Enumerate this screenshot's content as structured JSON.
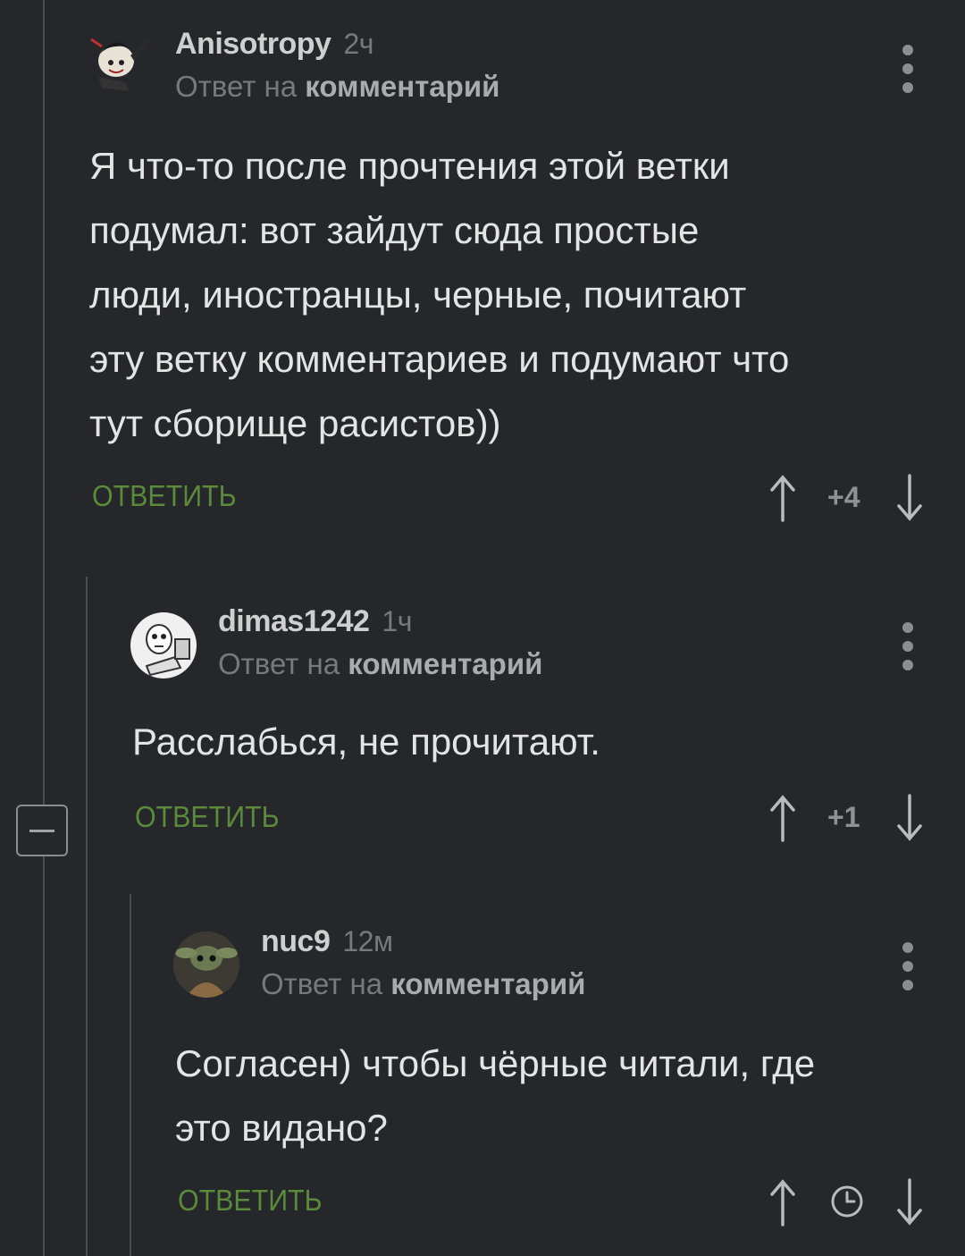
{
  "comments": [
    {
      "author": "Anisotropy",
      "time": "2ч",
      "reply_prefix": "Ответ на",
      "reply_link": "комментарий",
      "lines": [
        "Я что-то после прочтения этой ветки",
        "подумал: вот зайдут сюда простые",
        "люди, иностранцы, черные, почитают",
        "эту ветку комментариев и подумают что",
        "тут сборище расистов))"
      ],
      "reply_label": "ОТВЕТИТЬ",
      "score": "+4"
    },
    {
      "author": "dimas1242",
      "time": "1ч",
      "reply_prefix": "Ответ на",
      "reply_link": "комментарий",
      "lines": [
        "Расслабься, не прочитают."
      ],
      "reply_label": "ОТВЕТИТЬ",
      "score": "+1"
    },
    {
      "author": "nuc9",
      "time": "12м",
      "reply_prefix": "Ответ на",
      "reply_link": "комментарий",
      "lines": [
        "Согласен) чтобы чёрные читали, где",
        "это видано?"
      ],
      "reply_label": "ОТВЕТИТЬ",
      "score_icon": "clock-icon"
    }
  ],
  "colors": {
    "background": "#25272a",
    "reply_button": "#5a8a3a",
    "muted_text": "#77797d"
  }
}
